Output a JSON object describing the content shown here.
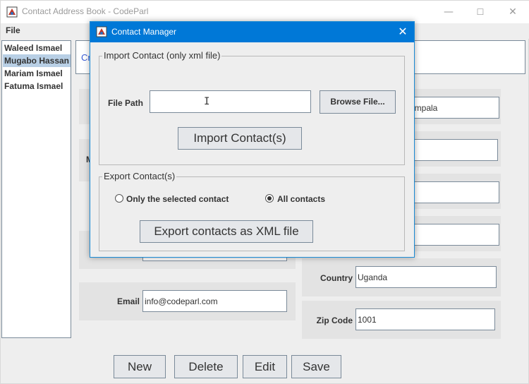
{
  "main_window": {
    "title": "Contact Address Book - CodeParl",
    "controls": {
      "minimize": "—",
      "maximize": "☐",
      "close": "✕"
    },
    "menu": {
      "file": "File"
    }
  },
  "contacts": [
    "Waleed Ismael",
    "Mugabo Hassan",
    "Mariam Ismael",
    "Fatuma Ismael"
  ],
  "selected_contact_index": 1,
  "header": {
    "link_text": "Cr"
  },
  "fields": {
    "label_m": "M",
    "city_value": "ampala",
    "country_label": "Country",
    "country_value": "Uganda",
    "email_label": "Email",
    "email_value": "info@codeparl.com",
    "zip_label": "Zip Code",
    "zip_value": "1001"
  },
  "buttons": {
    "new": "New",
    "delete": "Delete",
    "edit": "Edit",
    "save": "Save"
  },
  "dialog": {
    "title": "Contact Manager",
    "close": "✕",
    "import_group": "Import Contact (only xml file)",
    "file_path_label": "File Path",
    "file_path_value": "",
    "browse_button": "Browse File...",
    "import_button": "Import Contact(s)",
    "export_group": "Export Contact(s)",
    "radio_selected_only": "Only the selected contact",
    "radio_all": "All contacts",
    "radio_checked": "all",
    "export_button": "Export contacts as XML file"
  },
  "colors": {
    "dialog_titlebar": "#0078d7",
    "selection": "#b8cfe5",
    "link": "#3b5bd5"
  }
}
